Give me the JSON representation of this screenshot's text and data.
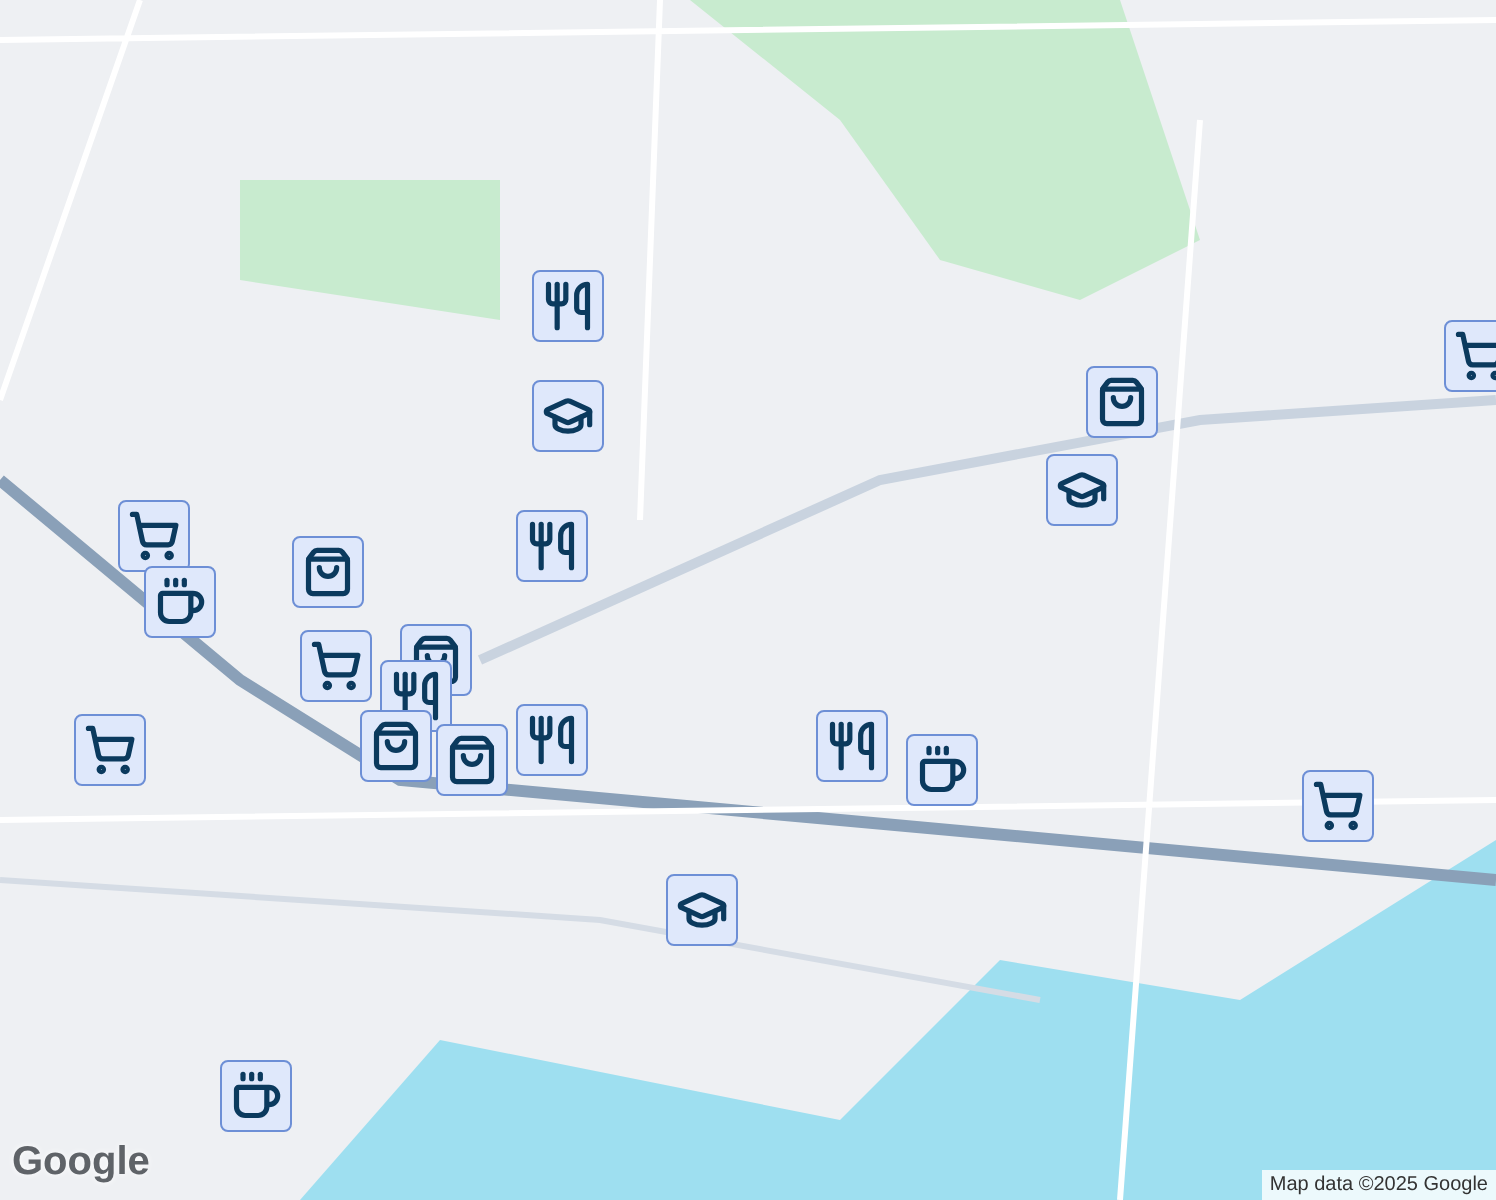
{
  "map": {
    "markers": [
      {
        "kind": "utensils"
      },
      {
        "kind": "school"
      },
      {
        "kind": "utensils"
      },
      {
        "kind": "bag"
      },
      {
        "kind": "school"
      },
      {
        "kind": "cart"
      },
      {
        "kind": "cart"
      },
      {
        "kind": "cup"
      },
      {
        "kind": "bag"
      },
      {
        "kind": "bag"
      },
      {
        "kind": "cart"
      },
      {
        "kind": "utensils"
      },
      {
        "kind": "bag"
      },
      {
        "kind": "bag"
      },
      {
        "kind": "utensils"
      },
      {
        "kind": "cart"
      },
      {
        "kind": "utensils"
      },
      {
        "kind": "cup"
      },
      {
        "kind": "cart"
      },
      {
        "kind": "school"
      },
      {
        "kind": "cup"
      }
    ]
  },
  "logo": "Google",
  "attribution": "Map data ©2025 Google"
}
